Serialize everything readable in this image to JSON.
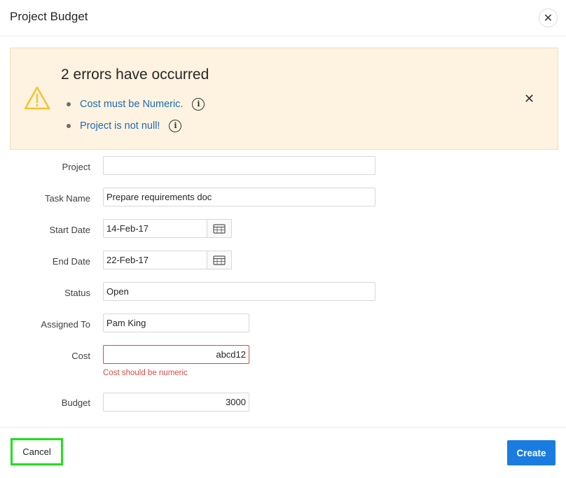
{
  "dialog": {
    "title": "Project Budget"
  },
  "alert": {
    "heading": "2 errors have occurred",
    "errors": [
      {
        "text": "Cost must be Numeric."
      },
      {
        "text": "Project is not null!"
      }
    ],
    "dismiss_icon": "close-icon",
    "warning_color": "#f4c430"
  },
  "form": {
    "project": {
      "label": "Project",
      "value": ""
    },
    "task_name": {
      "label": "Task Name",
      "value": "Prepare requirements doc"
    },
    "start_date": {
      "label": "Start Date",
      "value": "14-Feb-17"
    },
    "end_date": {
      "label": "End Date",
      "value": "22-Feb-17"
    },
    "status": {
      "label": "Status",
      "value": "Open"
    },
    "assigned_to": {
      "label": "Assigned To",
      "value": "Pam King"
    },
    "cost": {
      "label": "Cost",
      "value": "abcd12",
      "error": "Cost should be numeric"
    },
    "budget": {
      "label": "Budget",
      "value": "3000"
    }
  },
  "footer": {
    "cancel_label": "Cancel",
    "create_label": "Create"
  },
  "colors": {
    "primary": "#1a7be0",
    "error": "#d84a4a",
    "alert_bg": "#fef3e0",
    "link": "#1f6bb3",
    "highlight": "#22e01e"
  }
}
